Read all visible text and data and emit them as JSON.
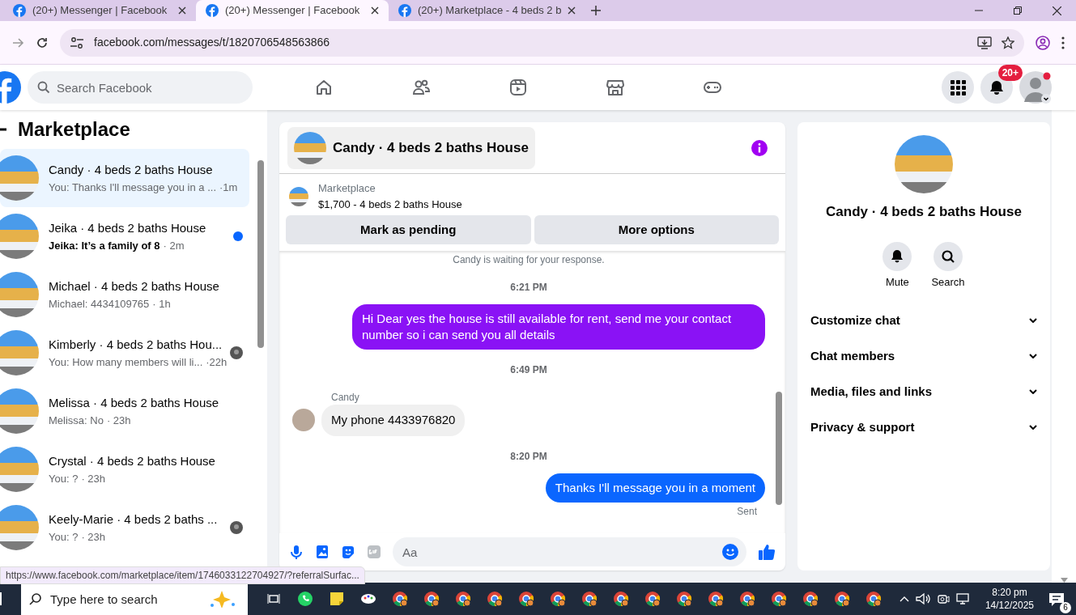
{
  "browser": {
    "tabs": [
      {
        "title": "(20+) Messenger | Facebook",
        "selected": false
      },
      {
        "title": "(20+) Messenger | Facebook",
        "selected": true
      },
      {
        "title": "(20+) Marketplace - 4 beds 2 b",
        "selected": false
      }
    ],
    "url": "facebook.com/messages/t/1820706548563866"
  },
  "topbar": {
    "search_placeholder": "Search Facebook",
    "nav": [
      {
        "kind": "home"
      },
      {
        "kind": "friends"
      },
      {
        "kind": "video"
      },
      {
        "kind": "marketplace"
      },
      {
        "kind": "gaming"
      }
    ],
    "notification_badge": "20+"
  },
  "sidebar": {
    "title": "Marketplace",
    "conversations": [
      {
        "name": "Candy · 4 beds 2 baths House",
        "preview": "You: Thanks I'll message you in a ...",
        "time": "·1m",
        "selected": true,
        "unread": false,
        "seen_avatar": false
      },
      {
        "name": "Jeika · 4 beds 2 baths House",
        "preview": "Jeika: It’s a family of 8",
        "time": "· 2m",
        "selected": false,
        "unread": true,
        "seen_avatar": false
      },
      {
        "name": "Michael · 4 beds 2 baths House",
        "preview": "Michael: 4434109765",
        "time": "· 1h",
        "selected": false,
        "unread": false,
        "seen_avatar": false
      },
      {
        "name": "Kimberly · 4 beds 2 baths Hou...",
        "preview": "You: How many members will li...",
        "time": "·22h",
        "selected": false,
        "unread": false,
        "seen_avatar": true
      },
      {
        "name": "Melissa · 4 beds 2 baths House",
        "preview": "Melissa: No",
        "time": "· 23h",
        "selected": false,
        "unread": false,
        "seen_avatar": false
      },
      {
        "name": "Crystal · 4 beds 2 baths House",
        "preview": "You: ?",
        "time": "· 23h",
        "selected": false,
        "unread": false,
        "seen_avatar": false
      },
      {
        "name": "Keely-Marie · 4 beds 2 baths ...",
        "preview": "You: ?",
        "time": "· 23h",
        "selected": false,
        "unread": false,
        "seen_avatar": true
      }
    ]
  },
  "chat": {
    "title": "Candy · 4 beds 2 baths House",
    "listing": {
      "label": "Marketplace",
      "item": "$1,700 - 4 beds 2 baths House"
    },
    "actions": [
      "Mark as pending",
      "More options"
    ],
    "messages": [
      {
        "kind": "notice",
        "text": "Candy is waiting for your response."
      },
      {
        "kind": "time",
        "text": "6:21 PM"
      },
      {
        "kind": "outgoing",
        "text": "Hi Dear yes the house is still available for rent, send me your contact number so i can send you all details",
        "color": "#8a12f5"
      },
      {
        "kind": "time",
        "text": "6:49 PM"
      },
      {
        "kind": "incoming",
        "sender": "Candy",
        "text": "My phone 4433976820"
      },
      {
        "kind": "time",
        "text": "8:20 PM"
      },
      {
        "kind": "outgoing",
        "text": "Thanks I'll message you in a moment",
        "color": "#0a66ff"
      },
      {
        "kind": "receipt",
        "text": "Sent"
      }
    ],
    "composer_placeholder": "Aa"
  },
  "details": {
    "title": "Candy · 4 beds 2 baths House",
    "actions": [
      {
        "kind": "mute",
        "label": "Mute"
      },
      {
        "kind": "search",
        "label": "Search"
      }
    ],
    "sections": [
      {
        "label": "Customize chat",
        "expanded": false
      },
      {
        "label": "Chat members",
        "expanded": false
      },
      {
        "label": "Media, files and links",
        "expanded": false
      },
      {
        "label": "Privacy & support",
        "expanded": false
      }
    ]
  },
  "status_url": "https://www.facebook.com/marketplace/item/1746033122704927/?referralSurfac...",
  "taskbar": {
    "search_placeholder": "Type here to search",
    "time": "8:20 pm",
    "date": "14/12/2025",
    "notifications": "6"
  }
}
